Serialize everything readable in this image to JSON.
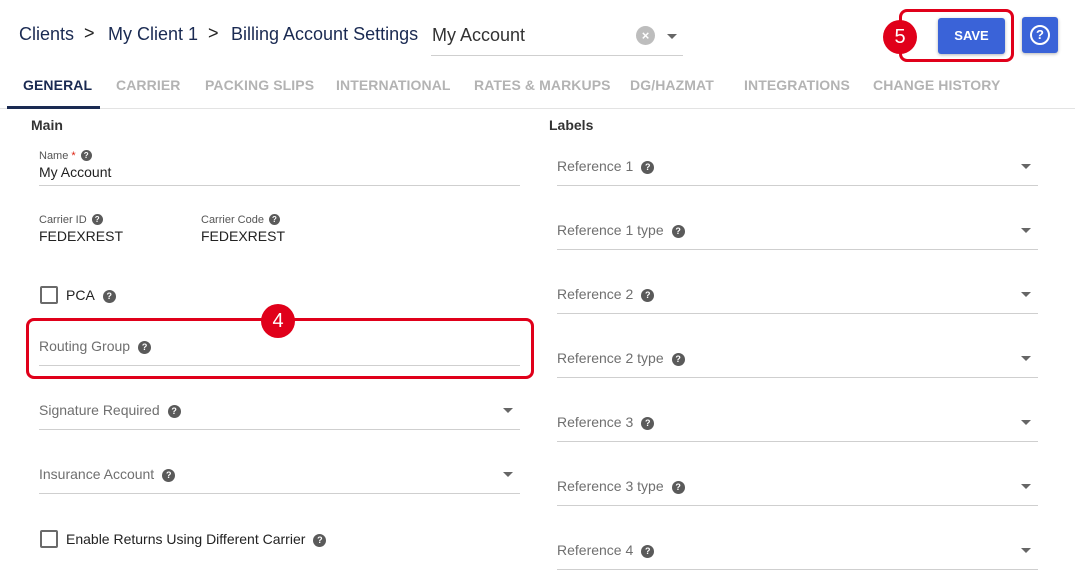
{
  "breadcrumb": {
    "items": [
      "Clients",
      "My Client 1",
      "Billing Account Settings"
    ],
    "separator": ">"
  },
  "account_select": {
    "value": "My Account",
    "clear_icon": "×"
  },
  "header": {
    "save_label": "SAVE",
    "help_icon": "?"
  },
  "annotations": {
    "save_number": "5",
    "routing_number": "4",
    "color": "#e0001a"
  },
  "tabs": [
    {
      "label": "GENERAL",
      "active": true
    },
    {
      "label": "CARRIER"
    },
    {
      "label": "PACKING SLIPS"
    },
    {
      "label": "INTERNATIONAL"
    },
    {
      "label": "RATES & MARKUPS"
    },
    {
      "label": "DG/HAZMAT"
    },
    {
      "label": "INTEGRATIONS"
    },
    {
      "label": "CHANGE HISTORY"
    }
  ],
  "main": {
    "title": "Main",
    "name": {
      "label": "Name",
      "required_mark": "*",
      "value": "My Account"
    },
    "carrier_id": {
      "label": "Carrier ID",
      "value": "FEDEXREST"
    },
    "carrier_code": {
      "label": "Carrier Code",
      "value": "FEDEXREST"
    },
    "pca": {
      "label": "PCA",
      "checked": false
    },
    "routing_group": {
      "label": "Routing Group"
    },
    "signature_required": {
      "label": "Signature Required"
    },
    "insurance_account": {
      "label": "Insurance Account"
    },
    "enable_returns": {
      "label": "Enable Returns Using Different Carrier",
      "checked": false
    }
  },
  "labels": {
    "title": "Labels",
    "fields": [
      "Reference 1",
      "Reference 1 type",
      "Reference 2",
      "Reference 2 type",
      "Reference 3",
      "Reference 3 type",
      "Reference 4"
    ]
  },
  "colors": {
    "primary": "#3a63d8",
    "nav_text": "#1a2a52",
    "tab_inactive": "#b3b3b3"
  }
}
